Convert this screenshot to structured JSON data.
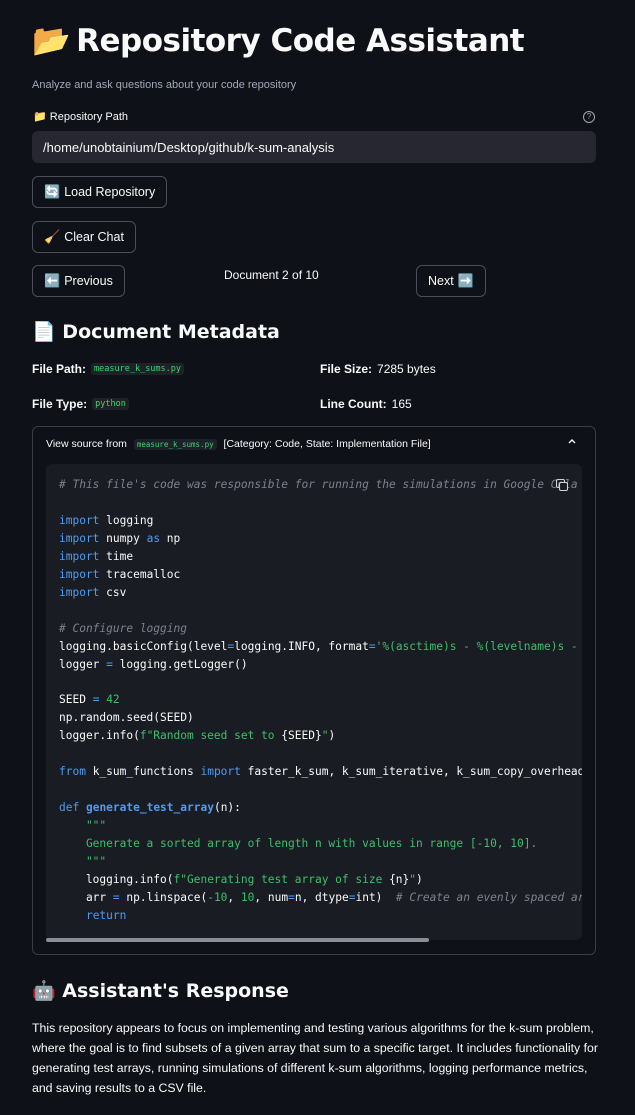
{
  "header": {
    "title_icon": "📂",
    "title": "Repository Code Assistant",
    "subtitle": "Analyze and ask questions about your code repository"
  },
  "repo_input": {
    "label_icon": "📁",
    "label": "Repository Path",
    "help_icon": "?",
    "value": "/home/unobtainium/Desktop/github/k-sum-analysis"
  },
  "buttons": {
    "load_icon": "🔄",
    "load": "Load Repository",
    "clear_icon": "🧹",
    "clear": "Clear Chat",
    "prev_icon": "⬅️",
    "prev": "Previous",
    "next": "Next",
    "next_icon": "➡️"
  },
  "navigation": {
    "counter": "Document 2 of 10"
  },
  "metadata": {
    "heading_icon": "📄",
    "heading": "Document Metadata",
    "file_path_label": "File Path:",
    "file_path": "measure_k_sums.py",
    "file_size_label": "File Size:",
    "file_size": "7285 bytes",
    "file_type_label": "File Type:",
    "file_type": "python",
    "line_count_label": "Line Count:",
    "line_count": "165"
  },
  "source_expander": {
    "prefix": "View source from",
    "file": "measure_k_sums.py",
    "suffix": "[Category: Code, State: Implementation File]",
    "chevron": "⌃",
    "code_lines": [
      "# This file's code was responsible for running the simulations in Google Cola",
      "",
      "import logging",
      "import numpy as np",
      "import time",
      "import tracemalloc",
      "import csv",
      "",
      "# Configure logging",
      "logging.basicConfig(level=logging.INFO, format='%(asctime)s - %(levelname)s -",
      "logger = logging.getLogger()",
      "",
      "SEED = 42",
      "np.random.seed(SEED)",
      "logger.info(f\"Random seed set to {SEED}\")",
      "",
      "from k_sum_functions import faster_k_sum, k_sum_iterative, k_sum_copy_overhead",
      "",
      "def generate_test_array(n):",
      "    \"\"\"",
      "    Generate a sorted array of length n with values in range [-10, 10].",
      "    \"\"\"",
      "    logging.info(f\"Generating test array of size {n}\")",
      "    arr = np.linspace(-10, 10, num=n, dtype=int)  # Create an evenly spaced ar",
      "    return"
    ]
  },
  "response": {
    "heading_icon": "🤖",
    "heading": "Assistant's Response",
    "text": "This repository appears to focus on implementing and testing various algorithms for the k-sum problem, where the goal is to find subsets of a given array that sum to a specific target. It includes functionality for generating test arrays, running simulations of different k-sum algorithms, logging performance metrics, and saving results to a CSV file."
  },
  "colors": {
    "background": "#0e1117",
    "input_background": "#262730",
    "code_background": "#1a1c24",
    "keyword": "#4f9cf0",
    "string": "#3fbf6a",
    "comment": "#7d828d"
  }
}
